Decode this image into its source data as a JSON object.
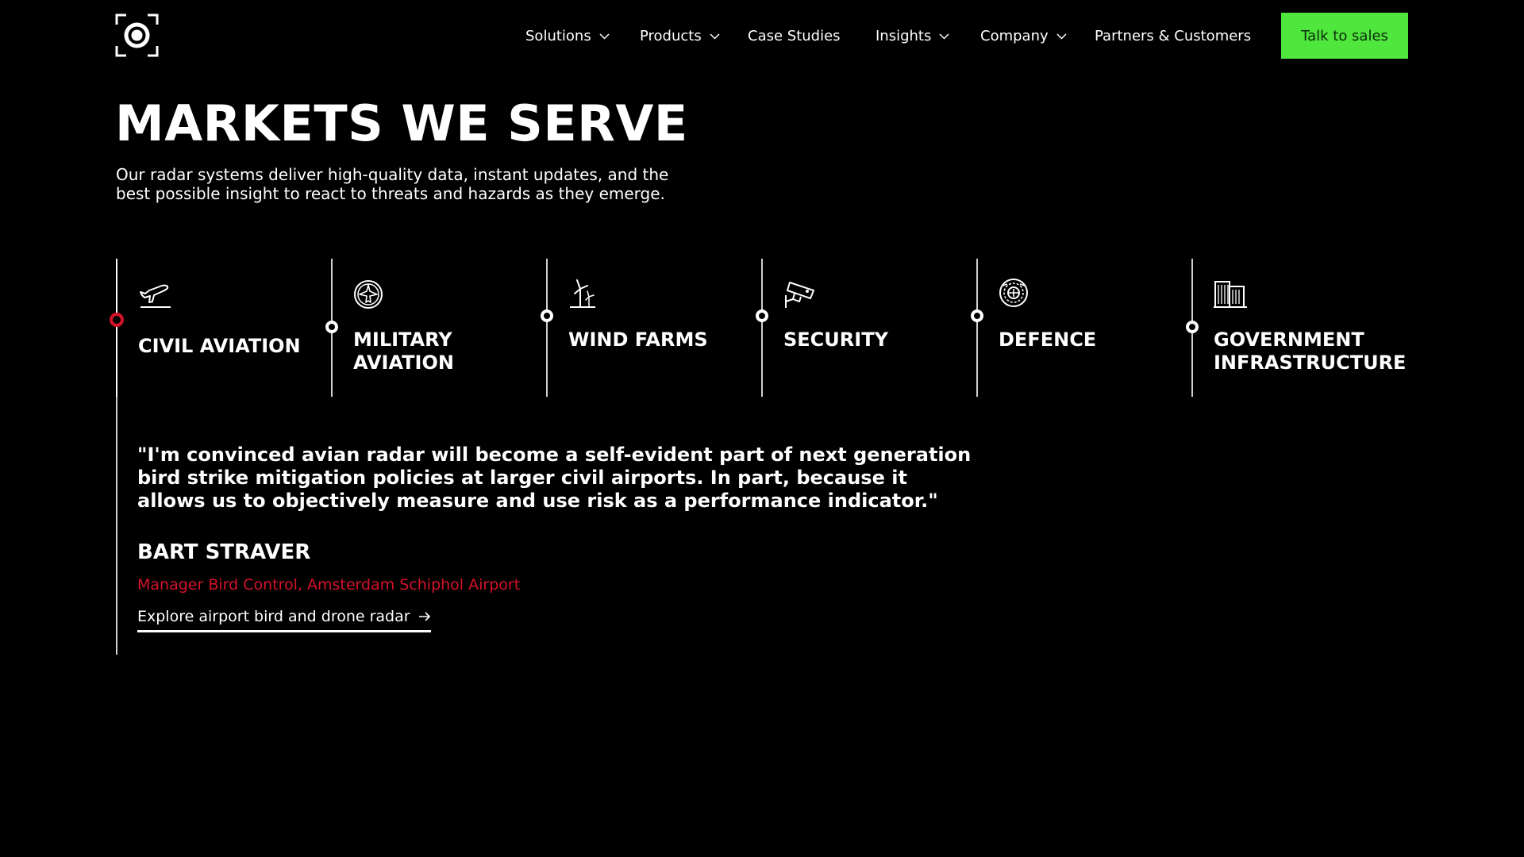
{
  "header": {
    "logo_icon": "radar-target-icon",
    "nav": [
      {
        "label": "Solutions",
        "dropdown": true
      },
      {
        "label": "Products",
        "dropdown": true
      },
      {
        "label": "Case Studies",
        "dropdown": false
      },
      {
        "label": "Insights",
        "dropdown": true
      },
      {
        "label": "Company",
        "dropdown": true
      },
      {
        "label": "Partners & Customers",
        "dropdown": false
      }
    ],
    "cta_label": "Talk to sales"
  },
  "hero": {
    "title": "MARKETS WE SERVE",
    "subtitle": "Our radar systems deliver high-quality data, instant updates, and the best possible insight to react to threats and hazards as they emerge."
  },
  "markets": [
    {
      "label": "CIVIL AVIATION",
      "icon": "airplane-takeoff-icon",
      "active": true
    },
    {
      "label": "MILITARY AVIATION",
      "icon": "military-jet-icon",
      "active": false
    },
    {
      "label": "WIND FARMS",
      "icon": "wind-turbine-icon",
      "active": false
    },
    {
      "label": "SECURITY",
      "icon": "security-camera-icon",
      "active": false
    },
    {
      "label": "DEFENCE",
      "icon": "defence-emblem-icon",
      "active": false
    },
    {
      "label": "GOVERNMENT INFRASTRUCTURE",
      "icon": "government-building-icon",
      "active": false
    }
  ],
  "quote": {
    "text": "\"I'm convinced avian radar will become a self-evident part of next generation bird strike mitigation policies at larger civil airports. In part, because it allows us to objectively measure and use risk as a performance indicator.\"",
    "author": "BART STRAVER",
    "role": "Manager Bird Control, Amsterdam Schiphol Airport",
    "link_label": "Explore airport bird and drone radar"
  },
  "colors": {
    "background": "#000000",
    "cta": "#4fe63d",
    "accent_red": "#d4122a"
  }
}
